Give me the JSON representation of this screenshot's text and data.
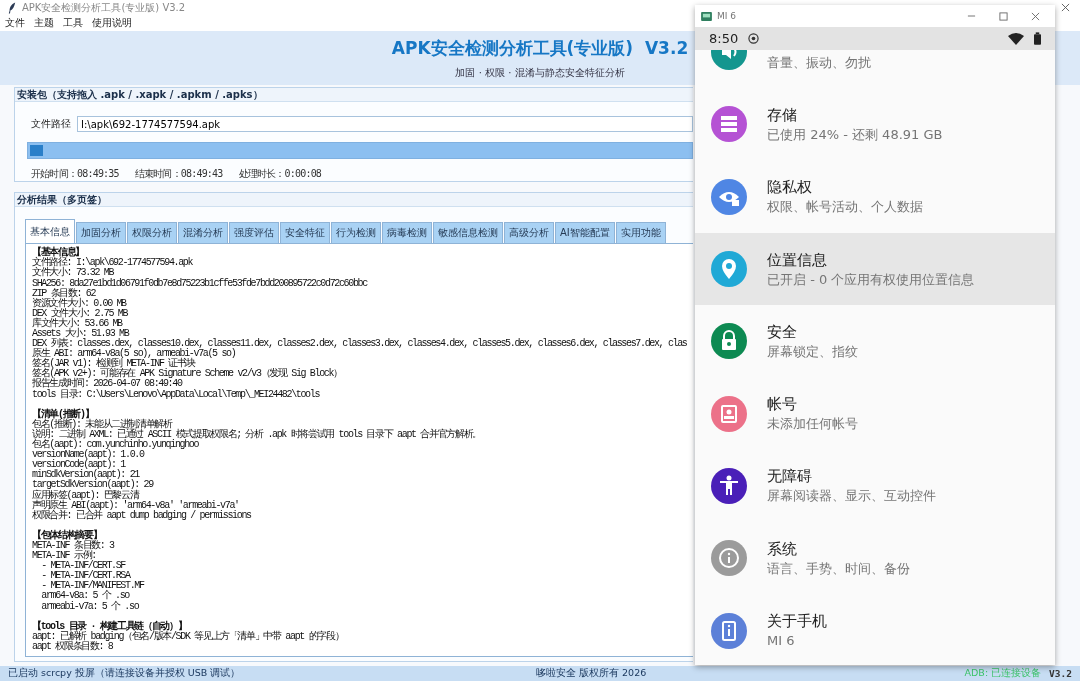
{
  "window": {
    "title": "APK安全检测分析工具(专业版) V3.2"
  },
  "menu": [
    "文件",
    "主题",
    "工具",
    "使用说明"
  ],
  "header": {
    "title": "APK安全检测分析工具(专业版)  V3.2",
    "subtitle": "加固 · 权限 · 混淆与静态安全特征分析"
  },
  "package_group": {
    "title": "安装包（支持拖入 .apk / .xapk / .apkm / .apks）",
    "path_label": "文件路径",
    "path_value": "I:\\apk\\692-1774577594.apk",
    "progress": {
      "level": 0.02
    },
    "times": [
      "开始时间：08:49:35",
      "结束时间：08:49:43",
      "处理时长：0:00:08"
    ]
  },
  "results_group": {
    "title": "分析结果（多页签）",
    "tabs": [
      {
        "label": "基本信息",
        "selected": true
      },
      {
        "label": "加固分析",
        "selected": false
      },
      {
        "label": "权限分析",
        "selected": false
      },
      {
        "label": "混淆分析",
        "selected": false
      },
      {
        "label": "强度评估",
        "selected": false
      },
      {
        "label": "安全特征",
        "selected": false
      },
      {
        "label": "行为检测",
        "selected": false
      },
      {
        "label": "病毒检测",
        "selected": false
      },
      {
        "label": "敏感信息检测",
        "selected": false
      },
      {
        "label": "高级分析",
        "selected": false
      },
      {
        "label": "AI智能配置",
        "selected": false
      },
      {
        "label": "实用功能",
        "selected": false
      }
    ],
    "report": [
      {
        "heading": "【基本信息】",
        "lines": [
          "文件路径: I:\\apk\\692-1774577594.apk",
          "文件大小: 73.32 MB",
          "SHA256: 8da27e1bd1d06791f0db7e8d75223b1cffe53fde7bdd200895722c0d72c60bbc",
          "ZIP 条目数: 62",
          "资源文件大小: 0.00 MB",
          "DEX 文件大小: 2.75 MB",
          "库文件大小: 53.66 MB",
          "Assets 大小: 51.93 MB",
          "DEX 列表: classes.dex, classes10.dex, classes11.dex, classes2.dex, classes3.dex, classes4.dex, classes5.dex, classes6.dex, classes7.dex, clas",
          "原生 ABI: arm64-v8a(5 so), armeabi-v7a(5 so)",
          "签名(JAR v1): 检测到 META-INF 证书块",
          "签名(APK v2+): 可能存在 APK Signature Scheme v2/v3（发现 Sig Block）",
          "报告生成时间: 2026-04-07 08:49:40",
          "tools 目录: C:\\Users\\Lenovo\\AppData\\Local\\Temp\\_MEI24482\\tools"
        ]
      },
      {
        "heading": "【清单(推断)】",
        "lines": [
          "包名(推断): 未能从二进制清单解析",
          "说明: 二进制 AXML: 已通过 ASCII 模式提取权限名; 分析 .apk 时将尝试用 tools 目录下 aapt 合并官方解析。",
          "包名(aapt): com.yunchinho.yunqinghoo",
          "versionName(aapt): 1.0.0",
          "versionCode(aapt): 1",
          "minSdkVersion(aapt): 21",
          "targetSdkVersion(aapt): 29",
          "应用标签(aapt): 巴黎云清",
          "声明原生 ABI(aapt): 'arm64-v8a' 'armeabi-v7a'",
          "权限合并: 已合并 aapt dump badging / permissions"
        ]
      },
      {
        "heading": "【包体结构摘要】",
        "lines": [
          "META-INF 条目数: 3",
          "META-INF 示例:",
          "  - META-INF/CERT.SF",
          "  - META-INF/CERT.RSA",
          "  - META-INF/MANIFEST.MF",
          "  arm64-v8a: 5 个 .so",
          "  armeabi-v7a: 5 个 .so"
        ]
      },
      {
        "heading": "【tools 目录 · 构建工具链（自动）】",
        "lines": [
          "aapt: 已解析 badging（包名/版本/SDK 等见上方「清单」中带 aapt 的字段）",
          "aapt 权限条目数: 8"
        ]
      }
    ]
  },
  "status_bar": {
    "left": "已启动 scrcpy 投屏（请连接设备并授权 USB 调试）",
    "center": "哆啦安全 版权所有 2026",
    "adb": "ADB: 已连接设备",
    "version": "V3.2"
  },
  "phone": {
    "title": "MI 6",
    "time": "8:50",
    "items": [
      {
        "subtitle": "音量、振动、勿扰",
        "color": "#14968f",
        "highlighted": false
      },
      {
        "title": "存储",
        "subtitle": "已使用 24% - 还剩 48.91 GB",
        "color": "#b552d4",
        "highlighted": false
      },
      {
        "title": "隐私权",
        "subtitle": "权限、帐号活动、个人数据",
        "color": "#4f86e4",
        "highlighted": false
      },
      {
        "title": "位置信息",
        "subtitle": "已开启 - 0 个应用有权使用位置信息",
        "color": "#20a9d6",
        "highlighted": true
      },
      {
        "title": "安全",
        "subtitle": "屏幕锁定、指纹",
        "color": "#0d8a52",
        "highlighted": false
      },
      {
        "title": "帐号",
        "subtitle": "未添加任何帐号",
        "color": "#ec7189",
        "highlighted": false
      },
      {
        "title": "无障碍",
        "subtitle": "屏幕阅读器、显示、互动控件",
        "color": "#4a1fb8",
        "highlighted": false
      },
      {
        "title": "系统",
        "subtitle": "语言、手势、时间、备份",
        "color": "#9b9b9b",
        "highlighted": false
      },
      {
        "title": "关于手机",
        "subtitle": "MI 6",
        "color": "#5c80d8",
        "highlighted": false
      }
    ]
  }
}
